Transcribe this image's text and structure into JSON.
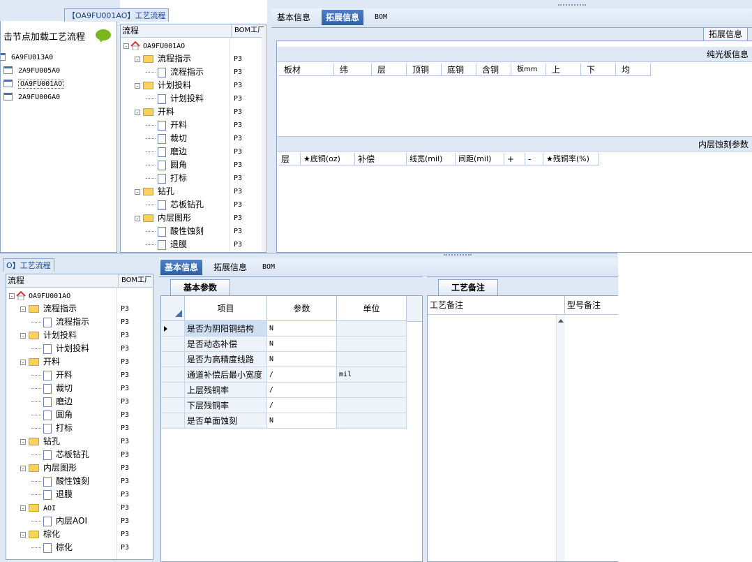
{
  "top_left": {
    "title": "【OA9FU001AO】工艺流程",
    "hint": "击节点加载工艺流程",
    "items": [
      "6A9FU013A0",
      "2A9FU005A0",
      "OA9FU001AO",
      "2A9FU006A0"
    ]
  },
  "top_tree": {
    "col_flow": "流程",
    "col_bom": "BOM工厂",
    "root": "OA9FU001AO",
    "rows": [
      {
        "label": "流程指示",
        "bom": "P3"
      },
      {
        "label": "流程指示",
        "bom": "P3"
      },
      {
        "label": "计划投料",
        "bom": "P3"
      },
      {
        "label": "计划投料",
        "bom": "P3"
      },
      {
        "label": "开料",
        "bom": "P3"
      },
      {
        "label": "开料",
        "bom": "P3"
      },
      {
        "label": "裁切",
        "bom": "P3"
      },
      {
        "label": "磨边",
        "bom": "P3"
      },
      {
        "label": "圆角",
        "bom": "P3"
      },
      {
        "label": "打标",
        "bom": "P3"
      },
      {
        "label": "钻孔",
        "bom": "P3"
      },
      {
        "label": "芯板钻孔",
        "bom": "P3"
      },
      {
        "label": "内层图形",
        "bom": "P3"
      },
      {
        "label": "酸性蚀刻",
        "bom": "P3"
      },
      {
        "label": "退膜",
        "bom": "P3"
      }
    ]
  },
  "top_right": {
    "tabs": [
      "基本信息",
      "拓展信息",
      "BOM"
    ],
    "ext_button": "拓展信息",
    "section1": "纯光板信息",
    "cols1": [
      "板材",
      "纬",
      "层",
      "顶铜",
      "底铜",
      "含铜",
      "板mm",
      "上",
      "下",
      "均"
    ],
    "section2": "内层蚀刻参数",
    "cols2": [
      "层",
      "★底铜(oz)",
      "补偿",
      "线宽(mil)",
      "间距(mil)",
      "+",
      "-",
      "★残铜率(%)"
    ]
  },
  "bottom_left": {
    "title": "O】工艺流程",
    "col_flow": "流程",
    "col_bom": "BOM工厂",
    "root": "OA9FU001AO",
    "rows": [
      {
        "label": "流程指示",
        "bom": "P3"
      },
      {
        "label": "流程指示",
        "bom": "P3"
      },
      {
        "label": "计划投料",
        "bom": "P3"
      },
      {
        "label": "计划投料",
        "bom": "P3"
      },
      {
        "label": "开料",
        "bom": "P3"
      },
      {
        "label": "开料",
        "bom": "P3"
      },
      {
        "label": "裁切",
        "bom": "P3"
      },
      {
        "label": "磨边",
        "bom": "P3"
      },
      {
        "label": "圆角",
        "bom": "P3"
      },
      {
        "label": "打标",
        "bom": "P3"
      },
      {
        "label": "钻孔",
        "bom": "P3"
      },
      {
        "label": "芯板钻孔",
        "bom": "P3"
      },
      {
        "label": "内层图形",
        "bom": "P3"
      },
      {
        "label": "酸性蚀刻",
        "bom": "P3"
      },
      {
        "label": "退膜",
        "bom": "P3"
      },
      {
        "label": "AOI",
        "bom": "P3"
      },
      {
        "label": "内层AOI",
        "bom": "P3"
      },
      {
        "label": "棕化",
        "bom": "P3"
      },
      {
        "label": "棕化",
        "bom": "P3"
      }
    ]
  },
  "bottom_right": {
    "tabs": [
      "基本信息",
      "拓展信息",
      "BOM"
    ],
    "basic_tab": "基本参数",
    "notes_tab": "工艺备注",
    "grid_headers": [
      "项目",
      "参数",
      "单位"
    ],
    "grid_rows": [
      {
        "item": "是否为阴阳铜结构",
        "param": "N",
        "unit": ""
      },
      {
        "item": "是否动态补偿",
        "param": "N",
        "unit": ""
      },
      {
        "item": "是否为高精度线路",
        "param": "N",
        "unit": ""
      },
      {
        "item": "通道补偿后最小宽度",
        "param": "/",
        "unit": "mil"
      },
      {
        "item": "上层残铜率",
        "param": "/",
        "unit": ""
      },
      {
        "item": "下层残铜率",
        "param": "/",
        "unit": ""
      },
      {
        "item": "是否单面蚀刻",
        "param": "N",
        "unit": ""
      }
    ],
    "notes_col1": "工艺备注",
    "notes_col2": "型号备注"
  }
}
